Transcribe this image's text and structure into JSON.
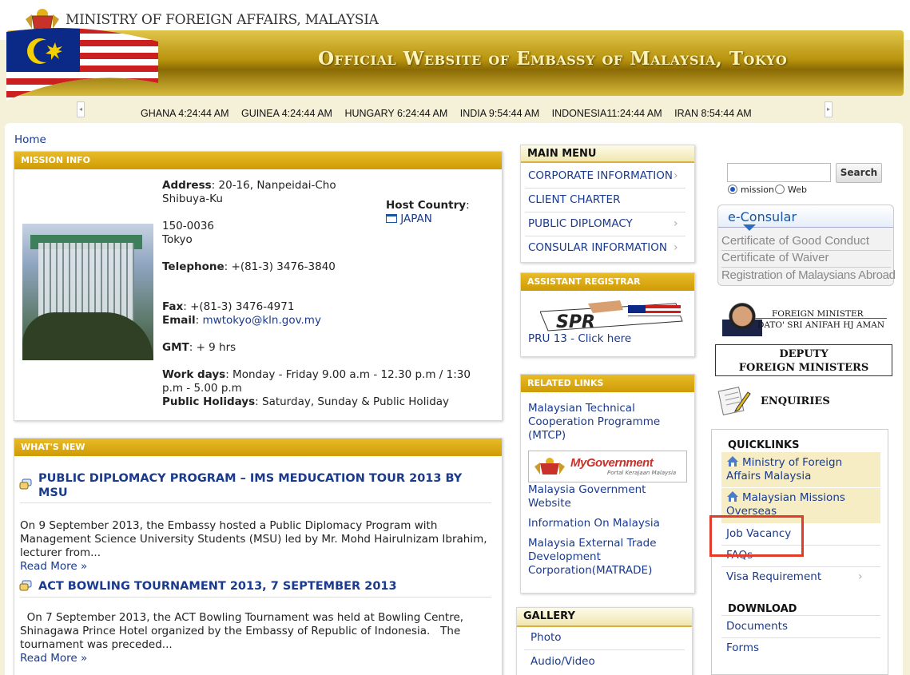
{
  "header": {
    "ministry": "MINISTRY OF FOREIGN AFFAIRS, MALAYSIA",
    "banner_title": "Official Website of Embassy of Malaysia, Tokyo"
  },
  "ticker": [
    {
      "country": "GHANA",
      "time": "4:24:44 AM"
    },
    {
      "country": "GUINEA",
      "time": "4:24:44 AM"
    },
    {
      "country": "HUNGARY",
      "time": "6:24:44 AM"
    },
    {
      "country": "INDIA",
      "time": "9:54:44 AM"
    },
    {
      "country": "INDONESIA",
      "time": "11:24:44 AM"
    },
    {
      "country": "IRAN",
      "time": "8:54:44 AM"
    }
  ],
  "breadcrumb": "Home",
  "mission": {
    "heading": "MISSION INFO",
    "address_label": "Address",
    "address_1": ": 20-16, Nanpeidai-Cho",
    "address_2": "Shibuya-Ku",
    "postcode": "150-0036",
    "city": "Tokyo",
    "telephone_label": "Telephone",
    "telephone": ": +(81-3) 3476-3840",
    "fax_label": "Fax",
    "fax": ": +(81-3) 3476-4971",
    "email_label": "Email",
    "email_sep": ": ",
    "email": "mwtokyo@kln.gov.my",
    "gmt_label": "GMT",
    "gmt": ": + 9 hrs",
    "workdays_label": "Work days",
    "workdays_1": ": Monday - Friday 9.00 a.m - 12.30 p.m / 1:30",
    "workdays_2": "p.m - 5.00 p.m",
    "holidays_label": "Public Holidays",
    "holidays": ": Saturday, Sunday & Public Holiday",
    "host_label": "Host Country",
    "host_colon": ":",
    "host_value": "JAPAN"
  },
  "whats_new": {
    "heading": "WHAT'S NEW",
    "items": [
      {
        "title": "PUBLIC DIPLOMACY PROGRAM – IMS MEDUCATION TOUR 2013 BY MSU",
        "text": "On 9 September 2013, the Embassy hosted a Public Diplomacy Program with Management Science University Students (MSU) led by Mr. Mohd Hairulnizam Ibrahim, lecturer from...",
        "read_more": "Read More »"
      },
      {
        "title": "ACT BOWLING TOURNAMENT 2013, 7 SEPTEMBER 2013",
        "text": "  On 7 September 2013, the ACT Bowling Tournament was held at Bowling Centre, Shinagawa Prince Hotel organized by the Embassy of Republic of Indonesia.   The tournament was preceded...",
        "read_more": "Read More »"
      }
    ]
  },
  "main_menu": {
    "heading": "MAIN MENU",
    "items": [
      "CORPORATE INFORMATION",
      "CLIENT CHARTER",
      "PUBLIC DIPLOMACY",
      "CONSULAR INFORMATION"
    ]
  },
  "assistant_registrar": {
    "heading": "ASSISTANT REGISTRAR",
    "logo_text": "SPR",
    "link": "PRU 13 - Click here"
  },
  "related_links": {
    "heading": "RELATED LINKS",
    "items": [
      "Malaysian Technical Cooperation Programme (MTCP)",
      "Malaysia Government Website",
      "Information On Malaysia",
      "Malaysia External Trade Development Corporation(MATRADE)"
    ],
    "mygov_text": "MyGovernment",
    "mygov_sub": "Portal Kerajaan Malaysia"
  },
  "gallery": {
    "heading": "GALLERY",
    "items": [
      "Photo",
      "Audio/Video"
    ]
  },
  "search": {
    "button": "Search",
    "opt_mission": "mission",
    "opt_web": "Web"
  },
  "econsular": {
    "title": "e-Consular",
    "links": [
      "Certificate of Good Conduct",
      "Certificate of Waiver",
      "Registration of Malaysians Abroad"
    ]
  },
  "minister": {
    "line1": "FOREIGN MINISTER",
    "line2": "DATO' SRI ANIFAH HJ AMAN"
  },
  "deputy": {
    "line1": "DEPUTY",
    "line2": "FOREIGN MINISTERS"
  },
  "enquiries": "ENQUIRIES",
  "quicklinks": {
    "heading": "QUICKLINKS",
    "items": [
      "Ministry of Foreign Affairs Malaysia",
      "Malaysian Missions Overseas",
      "Job Vacancy",
      "FAQs",
      "Visa Requirement"
    ]
  },
  "download": {
    "heading": "DOWNLOAD",
    "items": [
      "Documents",
      "Forms"
    ]
  },
  "colors": {
    "accent_gold": "#cf9b05",
    "link_blue": "#1a3a8c",
    "highlight_red": "#e23b2a"
  }
}
